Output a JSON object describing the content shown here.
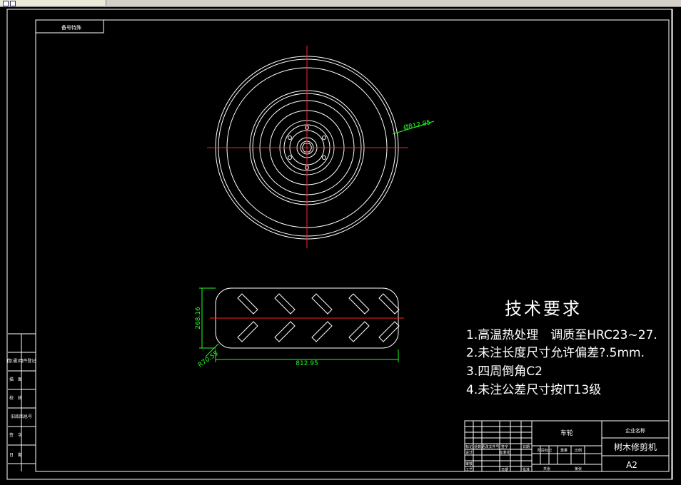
{
  "window": {
    "tab_icons": [
      "doc-icon",
      "doc-icon"
    ]
  },
  "drawing": {
    "stamp_box_text": "备号特殊",
    "left_strip_labels": [
      "借(通)用件登记",
      "描　图",
      "校　核",
      "旧底图总号",
      "签　字",
      "日　期"
    ],
    "dim_diameter": "Ø812.95",
    "dim_height": "268.16",
    "dim_radius": "R70.55",
    "dim_width": "812.95",
    "tech_title": "技术要求",
    "tech_items": [
      "1.高温热处理　调质至HRC23~27.",
      "2.未注长度尺寸允许偏差?.5mm.",
      "3.四周倒角C2",
      "4.未注公差尺寸按IT13级"
    ],
    "title_block": {
      "center_label": "车轮",
      "company_label": "企业名称",
      "product_name": "树木修剪机",
      "sheet_size": "A2",
      "row_labels_left": [
        "标记",
        "处数",
        "更改文件号",
        "签字",
        "日期",
        "设计",
        "标准化"
      ],
      "row_labels_right": [
        "阶段标记",
        "重量",
        "比例",
        "共张",
        "第张"
      ],
      "bottom_labels": [
        "审核",
        "工艺",
        "日期",
        "批准"
      ]
    }
  }
}
